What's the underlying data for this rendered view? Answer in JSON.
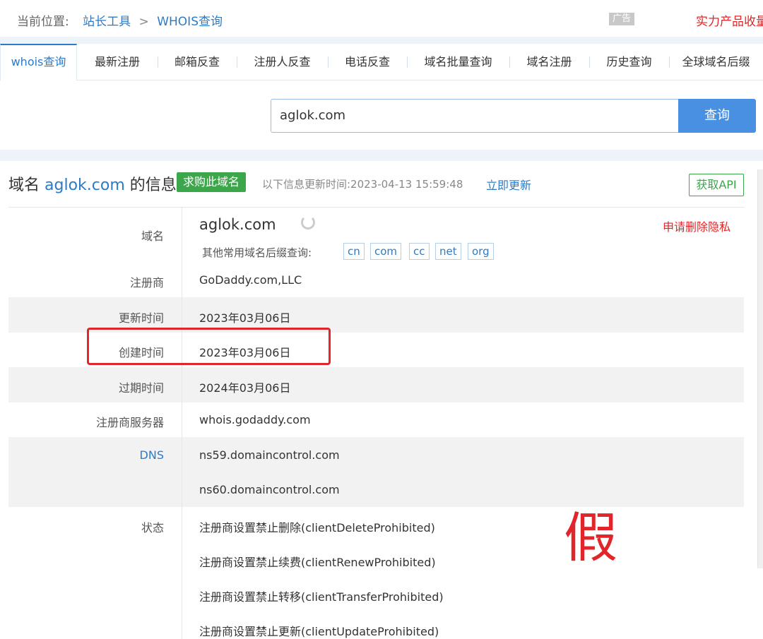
{
  "breadcrumb": {
    "prefix": "当前位置:",
    "home": "站长工具",
    "separator": ">",
    "current": "WHOIS查询"
  },
  "ad": {
    "badge": "广告",
    "text": "实力产品收量"
  },
  "tabs": [
    {
      "label": "whois查询",
      "active": true
    },
    {
      "label": "最新注册"
    },
    {
      "label": "邮箱反查"
    },
    {
      "label": "注册人反查"
    },
    {
      "label": "电话反查"
    },
    {
      "label": "域名批量查询"
    },
    {
      "label": "域名注册"
    },
    {
      "label": "历史查询"
    },
    {
      "label": "全球域名后缀"
    }
  ],
  "search": {
    "value": "aglok.com",
    "button_label": "查询"
  },
  "info": {
    "title_prefix": "域名",
    "domain": "aglok.com",
    "title_suffix": "的信息",
    "buy_label": "求购此域名",
    "update_text": "以下信息更新时间:2023-04-13 15:59:48",
    "update_link": "立即更新",
    "api_label": "获取API",
    "privacy_link": "申请删除隐私",
    "suffix_label": "其他常用域名后缀查询:",
    "suffixes": [
      "cn",
      "com",
      "cc",
      "net",
      "org"
    ]
  },
  "rows": {
    "domain": {
      "label": "域名",
      "value": "aglok.com"
    },
    "registrar": {
      "label": "注册商",
      "value": "GoDaddy.com,LLC"
    },
    "updated": {
      "label": "更新时间",
      "value": "2023年03月06日"
    },
    "created": {
      "label": "创建时间",
      "value": "2023年03月06日"
    },
    "expires": {
      "label": "过期时间",
      "value": "2024年03月06日"
    },
    "whois_server": {
      "label": "注册商服务器",
      "value": "whois.godaddy.com"
    },
    "dns": {
      "label": "DNS",
      "values": [
        "ns59.domaincontrol.com",
        "ns60.domaincontrol.com"
      ]
    },
    "status": {
      "label": "状态",
      "values": [
        "注册商设置禁止删除(clientDeleteProhibited)",
        "注册商设置禁止续费(clientRenewProhibited)",
        "注册商设置禁止转移(clientTransferProhibited)",
        "注册商设置禁止更新(clientUpdateProhibited)"
      ]
    }
  },
  "annotation": {
    "fake_mark": "假"
  },
  "colors": {
    "link": "#2d7bc7",
    "accent_red": "#e0262a",
    "green": "#3ca64a",
    "button_blue": "#4a90e2"
  }
}
